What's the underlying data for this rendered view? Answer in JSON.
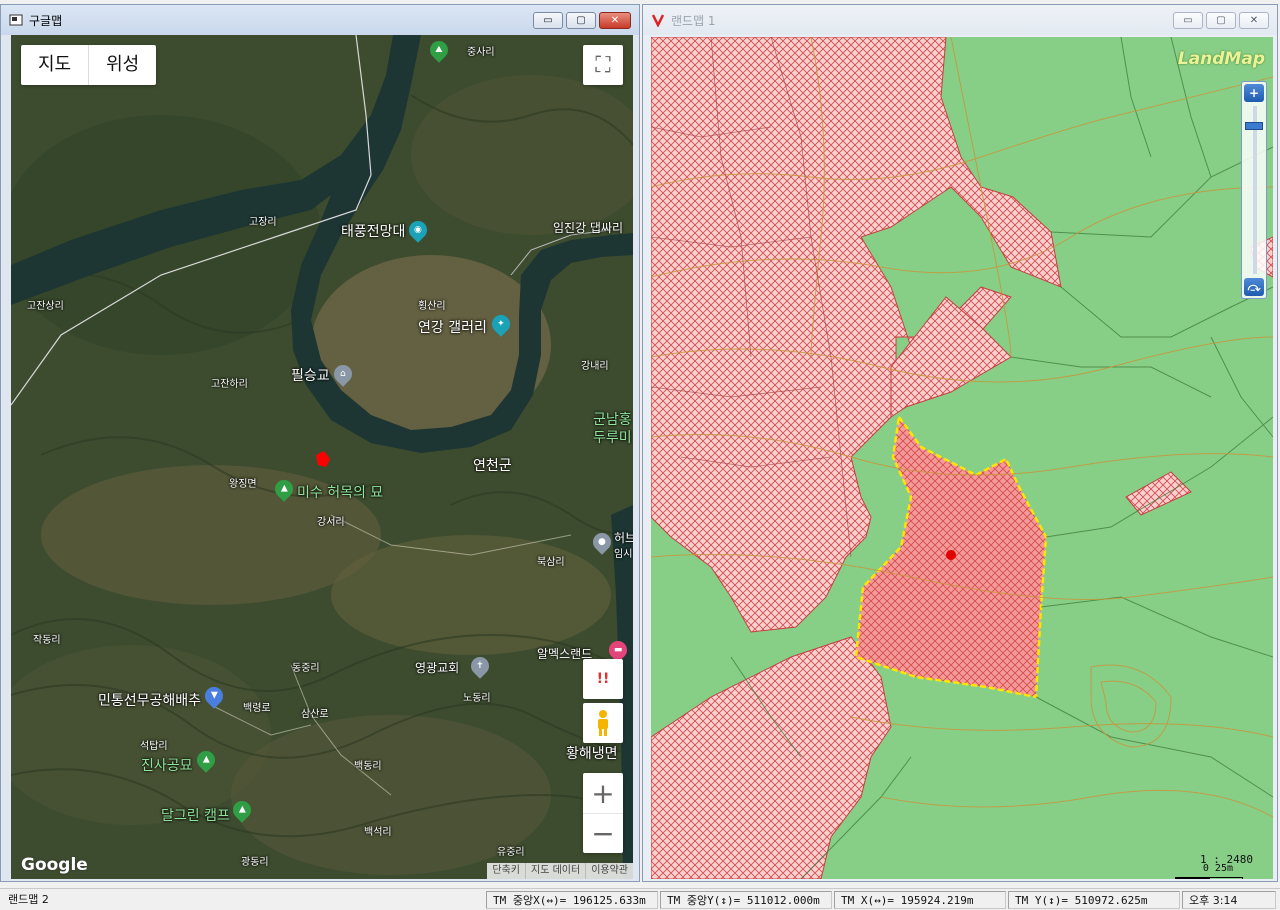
{
  "left_window": {
    "title": "구글맵",
    "buttons": {
      "minimize": "▭",
      "restore": "▢",
      "close": "✕"
    },
    "map_type": {
      "map_label": "지도",
      "satellite_label": "위성"
    },
    "labels": {
      "jungsari": "중사리",
      "gojangri": "고장리",
      "taepung": "태풍전망대",
      "imjingang": "임진강 댑싸리",
      "gojansangri": "고잔상리",
      "hwangsanri": "횡산리",
      "yeongang": "연강 갤러리",
      "pilseunggyo": "필승교",
      "gangnaeri": "강내리",
      "gojanhari": "고잔하리",
      "gunnam": "군남홍",
      "durumi": "두루미",
      "yeoncheon": "연천군",
      "wangjing": "왕징면",
      "misu": "미수 허목의 묘",
      "gangseori": "강서리",
      "heob": "허브",
      "imsi": "임시",
      "buksangri": "북삼리",
      "jakdongri": "작동리",
      "dongjungri": "동중리",
      "amexland": "알멕스랜드",
      "yeonggwang": "영광교회",
      "nodongri": "노동리",
      "mintong": "민통선무공해배추",
      "baekryeong": "백령로",
      "samsanro": "삼산로",
      "seoktapri": "석탑리",
      "hwanghae": "황해냉면",
      "jinsa": "진사공묘",
      "baekdongri": "백동리",
      "dalgeurin": "달그린 캠프",
      "baeksuri": "백석리",
      "yujungri": "유중리",
      "gwangdongri": "광동리"
    },
    "logo": "Google",
    "footer": {
      "shortcuts": "단축키",
      "map_data": "지도 데이터",
      "terms": "이용약관"
    },
    "controls": {
      "fullscreen_icon": "⛶",
      "alert": "!!",
      "zoom_in": "+",
      "zoom_out": "−"
    }
  },
  "right_window": {
    "title": "랜드맵 1",
    "buttons": {
      "minimize": "▭",
      "restore": "▢",
      "close": "✕"
    },
    "logo": "LandMap",
    "slider": {
      "zoom_in": "+",
      "reset": "⤼"
    },
    "scale": {
      "ratio": "1 : 2480",
      "bar_label": "0   25m"
    }
  },
  "statusbar": {
    "app_label": "랜드맵 2",
    "tm_center_x": "TM 중앙X(↔)= 196125.633m",
    "tm_center_y": "TM 중앙Y(↕)= 511012.000m",
    "tm_x": "TM X(↔)= 195924.219m",
    "tm_y": "TM Y(↕)= 510972.625m",
    "time": "오후 3:14"
  },
  "colors": {
    "satellite_base": "#3c4a2c",
    "river": "#1f3a38",
    "land_green": "#87cf87",
    "parcel_pink": "#f6c9c9",
    "parcel_hatch": "#d64848",
    "selected_fill": "#f29090",
    "selected_outline": "#ffe500"
  }
}
